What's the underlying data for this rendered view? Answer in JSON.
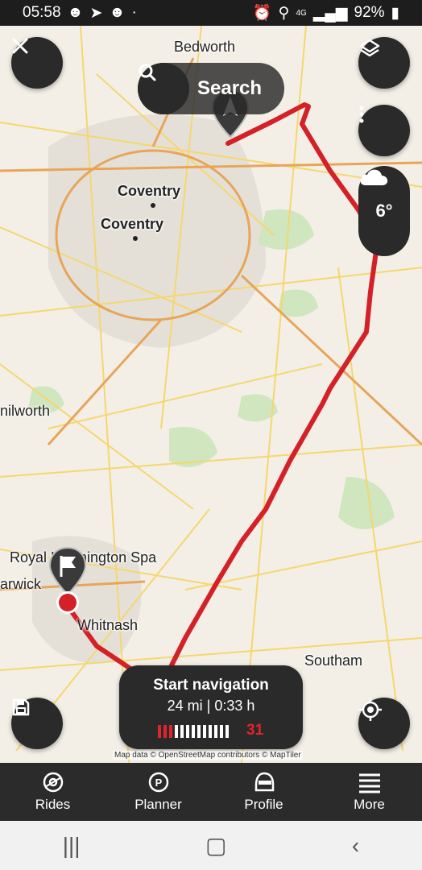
{
  "status_bar": {
    "time": "05:58",
    "battery": "92%",
    "network": "4G"
  },
  "map": {
    "places": [
      "Bedworth",
      "Coventry",
      "Coventry",
      "nilworth",
      "Royal Leamington Spa",
      "arwick",
      "Whitnash",
      "Southam"
    ],
    "attribution": "Map data © OpenStreetMap contributors © MapTiler",
    "route_color": "#d42027"
  },
  "top_bar": {
    "search_label": "Search"
  },
  "weather": {
    "temperature": "6°",
    "icon": "cloud-icon"
  },
  "navigation_card": {
    "title": "Start navigation",
    "summary": "24 mi | 0:33 h",
    "count": "31"
  },
  "bottom_nav": [
    {
      "label": "Rides",
      "icon": "rides-icon"
    },
    {
      "label": "Planner",
      "icon": "planner-icon"
    },
    {
      "label": "Profile",
      "icon": "profile-icon"
    },
    {
      "label": "More",
      "icon": "menu-icon"
    }
  ],
  "colors": {
    "accent": "#e0242b",
    "dark": "#2a2a2a"
  }
}
